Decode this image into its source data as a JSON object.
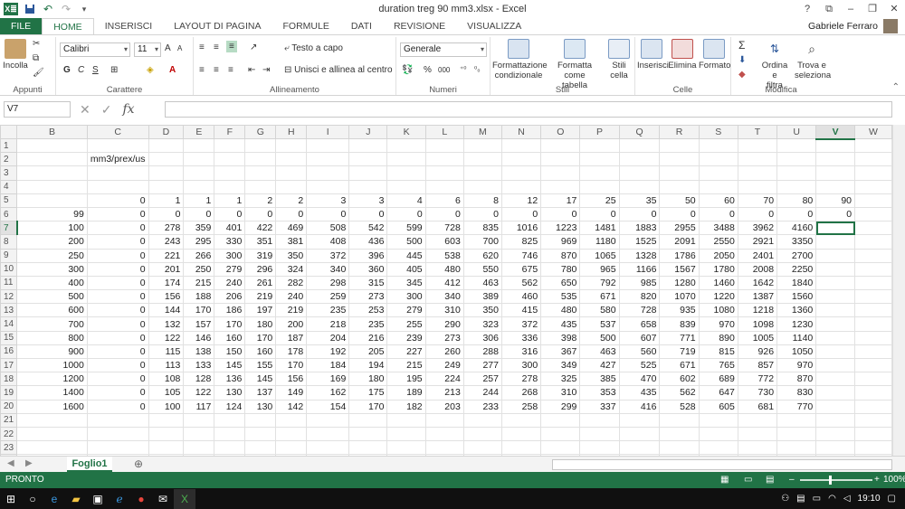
{
  "window": {
    "title": "duration treg  90 mm3.xlsx - Excel",
    "controls": [
      "?",
      "⧉",
      "–",
      "❐",
      "✕"
    ]
  },
  "qat": {
    "logo": "X≣",
    "save_icon": "save-icon",
    "undo_icon": "undo-icon",
    "redo_icon": "redo-icon"
  },
  "ribbon_tabs": [
    "FILE",
    "HOME",
    "INSERISCI",
    "LAYOUT DI PAGINA",
    "FORMULE",
    "DATI",
    "REVISIONE",
    "VISUALIZZA"
  ],
  "active_tab": "HOME",
  "user": {
    "name": "Gabriele Ferraro"
  },
  "ribbon": {
    "appunti": {
      "label": "Appunti",
      "paste": "Incolla"
    },
    "carattere": {
      "label": "Carattere",
      "font": "Calibri",
      "size": "11",
      "bold": "G",
      "italic": "C",
      "underline": "S",
      "grow": "A",
      "shrink": "A"
    },
    "allineamento": {
      "label": "Allineamento",
      "wrap": "Testo a capo",
      "merge": "Unisci e allinea al centro"
    },
    "numeri": {
      "label": "Numeri",
      "format": "Generale",
      "percent": "%",
      "thousands": "000"
    },
    "stili": {
      "label": "Stili",
      "cond1": "Formattazione",
      "cond2": "condizionale",
      "table1": "Formatta come",
      "table2": "tabella",
      "cell1": "Stili",
      "cell2": "cella"
    },
    "celle": {
      "label": "Celle",
      "insert": "Inserisci",
      "delete": "Elimina",
      "format": "Formato"
    },
    "modifica": {
      "label": "Modifica",
      "sort1": "Ordina e",
      "sort2": "filtra",
      "find1": "Trova e",
      "find2": "seleziona"
    }
  },
  "formula_bar": {
    "name_box": "V7",
    "fx": "fx",
    "content": ""
  },
  "sheet": {
    "columns": [
      "B",
      "C",
      "D",
      "E",
      "F",
      "G",
      "H",
      "I",
      "J",
      "K",
      "L",
      "M",
      "N",
      "O",
      "P",
      "Q",
      "R",
      "S",
      "T",
      "U",
      "V",
      "W"
    ],
    "selected_column": "V",
    "selected_row": "7",
    "rows": [
      {
        "n": "1",
        "cells": [
          "",
          "",
          "",
          "",
          "",
          "",
          "",
          "",
          "",
          "",
          "",
          "",
          "",
          "",
          "",
          "",
          "",
          "",
          "",
          "",
          "",
          ""
        ]
      },
      {
        "n": "2",
        "cells": [
          "",
          "mm3/prex/us",
          "",
          "",
          "",
          "",
          "",
          "",
          "",
          "",
          "",
          "",
          "",
          "",
          "",
          "",
          "",
          "",
          "",
          "",
          "",
          ""
        ]
      },
      {
        "n": "3",
        "cells": [
          "",
          "",
          "",
          "",
          "",
          "",
          "",
          "",
          "",
          "",
          "",
          "",
          "",
          "",
          "",
          "",
          "",
          "",
          "",
          "",
          "",
          ""
        ]
      },
      {
        "n": "4",
        "cells": [
          "",
          "",
          "",
          "",
          "",
          "",
          "",
          "",
          "",
          "",
          "",
          "",
          "",
          "",
          "",
          "",
          "",
          "",
          "",
          "",
          "",
          ""
        ]
      },
      {
        "n": "5",
        "cells": [
          "",
          "0",
          "1",
          "1",
          "1",
          "2",
          "2",
          "3",
          "3",
          "4",
          "6",
          "8",
          "12",
          "17",
          "25",
          "35",
          "50",
          "60",
          "70",
          "80",
          "90",
          ""
        ]
      },
      {
        "n": "6",
        "cells": [
          "99",
          "0",
          "0",
          "0",
          "0",
          "0",
          "0",
          "0",
          "0",
          "0",
          "0",
          "0",
          "0",
          "0",
          "0",
          "0",
          "0",
          "0",
          "0",
          "0",
          "0",
          ""
        ]
      },
      {
        "n": "7",
        "cells": [
          "100",
          "0",
          "278",
          "359",
          "401",
          "422",
          "469",
          "508",
          "542",
          "599",
          "728",
          "835",
          "1016",
          "1223",
          "1481",
          "1883",
          "2955",
          "3488",
          "3962",
          "4160",
          "",
          ""
        ]
      },
      {
        "n": "8",
        "cells": [
          "200",
          "0",
          "243",
          "295",
          "330",
          "351",
          "381",
          "408",
          "436",
          "500",
          "603",
          "700",
          "825",
          "969",
          "1180",
          "1525",
          "2091",
          "2550",
          "2921",
          "3350",
          "",
          ""
        ]
      },
      {
        "n": "9",
        "cells": [
          "250",
          "0",
          "221",
          "266",
          "300",
          "319",
          "350",
          "372",
          "396",
          "445",
          "538",
          "620",
          "746",
          "870",
          "1065",
          "1328",
          "1786",
          "2050",
          "2401",
          "2700",
          "",
          ""
        ]
      },
      {
        "n": "10",
        "cells": [
          "300",
          "0",
          "201",
          "250",
          "279",
          "296",
          "324",
          "340",
          "360",
          "405",
          "480",
          "550",
          "675",
          "780",
          "965",
          "1166",
          "1567",
          "1780",
          "2008",
          "2250",
          "",
          ""
        ]
      },
      {
        "n": "11",
        "cells": [
          "400",
          "0",
          "174",
          "215",
          "240",
          "261",
          "282",
          "298",
          "315",
          "345",
          "412",
          "463",
          "562",
          "650",
          "792",
          "985",
          "1280",
          "1460",
          "1642",
          "1840",
          "",
          ""
        ]
      },
      {
        "n": "12",
        "cells": [
          "500",
          "0",
          "156",
          "188",
          "206",
          "219",
          "240",
          "259",
          "273",
          "300",
          "340",
          "389",
          "460",
          "535",
          "671",
          "820",
          "1070",
          "1220",
          "1387",
          "1560",
          "",
          ""
        ]
      },
      {
        "n": "13",
        "cells": [
          "600",
          "0",
          "144",
          "170",
          "186",
          "197",
          "219",
          "235",
          "253",
          "279",
          "310",
          "350",
          "415",
          "480",
          "580",
          "728",
          "935",
          "1080",
          "1218",
          "1360",
          "",
          ""
        ]
      },
      {
        "n": "14",
        "cells": [
          "700",
          "0",
          "132",
          "157",
          "170",
          "180",
          "200",
          "218",
          "235",
          "255",
          "290",
          "323",
          "372",
          "435",
          "537",
          "658",
          "839",
          "970",
          "1098",
          "1230",
          "",
          ""
        ]
      },
      {
        "n": "15",
        "cells": [
          "800",
          "0",
          "122",
          "146",
          "160",
          "170",
          "187",
          "204",
          "216",
          "239",
          "273",
          "306",
          "336",
          "398",
          "500",
          "607",
          "771",
          "890",
          "1005",
          "1140",
          "",
          ""
        ]
      },
      {
        "n": "16",
        "cells": [
          "900",
          "0",
          "115",
          "138",
          "150",
          "160",
          "178",
          "192",
          "205",
          "227",
          "260",
          "288",
          "316",
          "367",
          "463",
          "560",
          "719",
          "815",
          "926",
          "1050",
          "",
          ""
        ]
      },
      {
        "n": "17",
        "cells": [
          "1000",
          "0",
          "113",
          "133",
          "145",
          "155",
          "170",
          "184",
          "194",
          "215",
          "249",
          "277",
          "300",
          "349",
          "427",
          "525",
          "671",
          "765",
          "857",
          "970",
          "",
          ""
        ]
      },
      {
        "n": "18",
        "cells": [
          "1200",
          "0",
          "108",
          "128",
          "136",
          "145",
          "156",
          "169",
          "180",
          "195",
          "224",
          "257",
          "278",
          "325",
          "385",
          "470",
          "602",
          "689",
          "772",
          "870",
          "",
          ""
        ]
      },
      {
        "n": "19",
        "cells": [
          "1400",
          "0",
          "105",
          "122",
          "130",
          "137",
          "149",
          "162",
          "175",
          "189",
          "213",
          "244",
          "268",
          "310",
          "353",
          "435",
          "562",
          "647",
          "730",
          "830",
          "",
          ""
        ]
      },
      {
        "n": "20",
        "cells": [
          "1600",
          "0",
          "100",
          "117",
          "124",
          "130",
          "142",
          "154",
          "170",
          "182",
          "203",
          "233",
          "258",
          "299",
          "337",
          "416",
          "528",
          "605",
          "681",
          "770",
          "",
          ""
        ]
      },
      {
        "n": "21",
        "cells": [
          "",
          "",
          "",
          "",
          "",
          "",
          "",
          "",
          "",
          "",
          "",
          "",
          "",
          "",
          "",
          "",
          "",
          "",
          "",
          "",
          "",
          ""
        ]
      },
      {
        "n": "22",
        "cells": [
          "",
          "",
          "",
          "",
          "",
          "",
          "",
          "",
          "",
          "",
          "",
          "",
          "",
          "",
          "",
          "",
          "",
          "",
          "",
          "",
          "",
          ""
        ]
      },
      {
        "n": "23",
        "cells": [
          "",
          "",
          "",
          "",
          "",
          "",
          "",
          "",
          "",
          "",
          "",
          "",
          "",
          "",
          "",
          "",
          "",
          "",
          "",
          "",
          "",
          ""
        ]
      },
      {
        "n": "24",
        "cells": [
          "",
          "",
          "",
          "",
          "",
          "",
          "",
          "",
          "",
          "",
          "",
          "",
          "",
          "",
          "",
          "",
          "",
          "",
          "",
          "",
          "",
          ""
        ]
      }
    ]
  },
  "sheet_tabs": [
    "Foglio1"
  ],
  "add_sheet": "⊕",
  "status": {
    "mode": "PRONTO",
    "zoom": "100%"
  },
  "taskbar": {
    "time": "19:10"
  },
  "colors": {
    "accent": "#217346",
    "taskbar": "#101010"
  }
}
